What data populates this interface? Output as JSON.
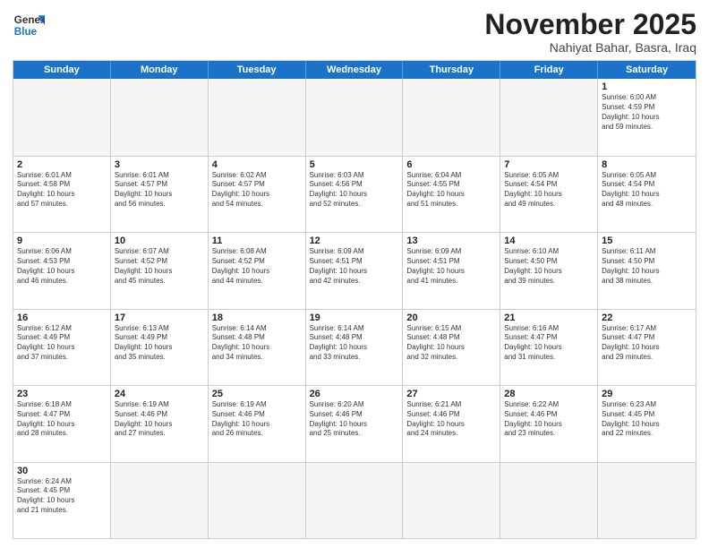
{
  "header": {
    "logo_general": "General",
    "logo_blue": "Blue",
    "month_title": "November 2025",
    "location": "Nahiyat Bahar, Basra, Iraq"
  },
  "weekdays": [
    "Sunday",
    "Monday",
    "Tuesday",
    "Wednesday",
    "Thursday",
    "Friday",
    "Saturday"
  ],
  "weeks": [
    [
      {
        "day": "",
        "info": "",
        "empty": true
      },
      {
        "day": "",
        "info": "",
        "empty": true
      },
      {
        "day": "",
        "info": "",
        "empty": true
      },
      {
        "day": "",
        "info": "",
        "empty": true
      },
      {
        "day": "",
        "info": "",
        "empty": true
      },
      {
        "day": "",
        "info": "",
        "empty": true
      },
      {
        "day": "1",
        "info": "Sunrise: 6:00 AM\nSunset: 4:59 PM\nDaylight: 10 hours\nand 59 minutes.",
        "empty": false
      }
    ],
    [
      {
        "day": "2",
        "info": "Sunrise: 6:01 AM\nSunset: 4:58 PM\nDaylight: 10 hours\nand 57 minutes.",
        "empty": false
      },
      {
        "day": "3",
        "info": "Sunrise: 6:01 AM\nSunset: 4:57 PM\nDaylight: 10 hours\nand 56 minutes.",
        "empty": false
      },
      {
        "day": "4",
        "info": "Sunrise: 6:02 AM\nSunset: 4:57 PM\nDaylight: 10 hours\nand 54 minutes.",
        "empty": false
      },
      {
        "day": "5",
        "info": "Sunrise: 6:03 AM\nSunset: 4:56 PM\nDaylight: 10 hours\nand 52 minutes.",
        "empty": false
      },
      {
        "day": "6",
        "info": "Sunrise: 6:04 AM\nSunset: 4:55 PM\nDaylight: 10 hours\nand 51 minutes.",
        "empty": false
      },
      {
        "day": "7",
        "info": "Sunrise: 6:05 AM\nSunset: 4:54 PM\nDaylight: 10 hours\nand 49 minutes.",
        "empty": false
      },
      {
        "day": "8",
        "info": "Sunrise: 6:05 AM\nSunset: 4:54 PM\nDaylight: 10 hours\nand 48 minutes.",
        "empty": false
      }
    ],
    [
      {
        "day": "9",
        "info": "Sunrise: 6:06 AM\nSunset: 4:53 PM\nDaylight: 10 hours\nand 46 minutes.",
        "empty": false
      },
      {
        "day": "10",
        "info": "Sunrise: 6:07 AM\nSunset: 4:52 PM\nDaylight: 10 hours\nand 45 minutes.",
        "empty": false
      },
      {
        "day": "11",
        "info": "Sunrise: 6:08 AM\nSunset: 4:52 PM\nDaylight: 10 hours\nand 44 minutes.",
        "empty": false
      },
      {
        "day": "12",
        "info": "Sunrise: 6:09 AM\nSunset: 4:51 PM\nDaylight: 10 hours\nand 42 minutes.",
        "empty": false
      },
      {
        "day": "13",
        "info": "Sunrise: 6:09 AM\nSunset: 4:51 PM\nDaylight: 10 hours\nand 41 minutes.",
        "empty": false
      },
      {
        "day": "14",
        "info": "Sunrise: 6:10 AM\nSunset: 4:50 PM\nDaylight: 10 hours\nand 39 minutes.",
        "empty": false
      },
      {
        "day": "15",
        "info": "Sunrise: 6:11 AM\nSunset: 4:50 PM\nDaylight: 10 hours\nand 38 minutes.",
        "empty": false
      }
    ],
    [
      {
        "day": "16",
        "info": "Sunrise: 6:12 AM\nSunset: 4:49 PM\nDaylight: 10 hours\nand 37 minutes.",
        "empty": false
      },
      {
        "day": "17",
        "info": "Sunrise: 6:13 AM\nSunset: 4:49 PM\nDaylight: 10 hours\nand 35 minutes.",
        "empty": false
      },
      {
        "day": "18",
        "info": "Sunrise: 6:14 AM\nSunset: 4:48 PM\nDaylight: 10 hours\nand 34 minutes.",
        "empty": false
      },
      {
        "day": "19",
        "info": "Sunrise: 6:14 AM\nSunset: 4:48 PM\nDaylight: 10 hours\nand 33 minutes.",
        "empty": false
      },
      {
        "day": "20",
        "info": "Sunrise: 6:15 AM\nSunset: 4:48 PM\nDaylight: 10 hours\nand 32 minutes.",
        "empty": false
      },
      {
        "day": "21",
        "info": "Sunrise: 6:16 AM\nSunset: 4:47 PM\nDaylight: 10 hours\nand 31 minutes.",
        "empty": false
      },
      {
        "day": "22",
        "info": "Sunrise: 6:17 AM\nSunset: 4:47 PM\nDaylight: 10 hours\nand 29 minutes.",
        "empty": false
      }
    ],
    [
      {
        "day": "23",
        "info": "Sunrise: 6:18 AM\nSunset: 4:47 PM\nDaylight: 10 hours\nand 28 minutes.",
        "empty": false
      },
      {
        "day": "24",
        "info": "Sunrise: 6:19 AM\nSunset: 4:46 PM\nDaylight: 10 hours\nand 27 minutes.",
        "empty": false
      },
      {
        "day": "25",
        "info": "Sunrise: 6:19 AM\nSunset: 4:46 PM\nDaylight: 10 hours\nand 26 minutes.",
        "empty": false
      },
      {
        "day": "26",
        "info": "Sunrise: 6:20 AM\nSunset: 4:46 PM\nDaylight: 10 hours\nand 25 minutes.",
        "empty": false
      },
      {
        "day": "27",
        "info": "Sunrise: 6:21 AM\nSunset: 4:46 PM\nDaylight: 10 hours\nand 24 minutes.",
        "empty": false
      },
      {
        "day": "28",
        "info": "Sunrise: 6:22 AM\nSunset: 4:46 PM\nDaylight: 10 hours\nand 23 minutes.",
        "empty": false
      },
      {
        "day": "29",
        "info": "Sunrise: 6:23 AM\nSunset: 4:45 PM\nDaylight: 10 hours\nand 22 minutes.",
        "empty": false
      }
    ],
    [
      {
        "day": "30",
        "info": "Sunrise: 6:24 AM\nSunset: 4:45 PM\nDaylight: 10 hours\nand 21 minutes.",
        "empty": false
      },
      {
        "day": "",
        "info": "",
        "empty": true
      },
      {
        "day": "",
        "info": "",
        "empty": true
      },
      {
        "day": "",
        "info": "",
        "empty": true
      },
      {
        "day": "",
        "info": "",
        "empty": true
      },
      {
        "day": "",
        "info": "",
        "empty": true
      },
      {
        "day": "",
        "info": "",
        "empty": true
      }
    ]
  ]
}
